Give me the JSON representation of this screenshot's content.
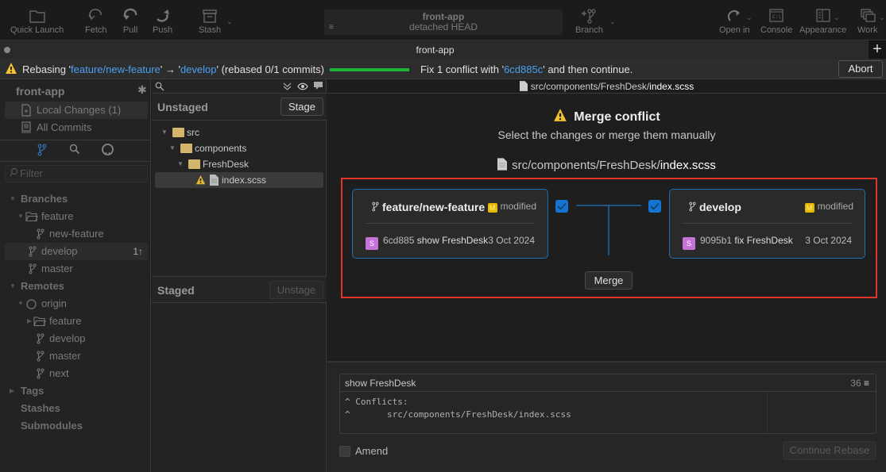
{
  "toolbar": {
    "quick_launch": "Quick Launch",
    "fetch": "Fetch",
    "pull": "Pull",
    "push": "Push",
    "stash": "Stash",
    "repo_name": "front-app",
    "repo_state": "detached HEAD",
    "branch": "Branch",
    "open_in": "Open in",
    "console": "Console",
    "appearance": "Appearance",
    "work": "Work"
  },
  "tab": {
    "title": "front-app",
    "add": "+"
  },
  "rebase": {
    "prefix": "Rebasing '",
    "source": "feature/new-feature",
    "arrow": "' → '",
    "target": "develop",
    "suffix": "' (rebased 0/1 commits)",
    "progress_fraction": 0,
    "fix_prefix": "Fix 1 conflict with '",
    "commit": "6cd885c",
    "fix_suffix": "' and then continue.",
    "abort": "Abort"
  },
  "sidebar": {
    "repo": "front-app",
    "local_changes": "Local Changes (1)",
    "all_commits": "All Commits",
    "filter_placeholder": "Filter",
    "branches_header": "Branches",
    "feature_folder": "feature",
    "new_feature": "new-feature",
    "develop": "develop",
    "develop_badge": "1↑",
    "master": "master",
    "remotes_header": "Remotes",
    "origin": "origin",
    "remote_feature": "feature",
    "remote_develop": "develop",
    "remote_master": "master",
    "remote_next": "next",
    "tags": "Tags",
    "stashes": "Stashes",
    "submodules": "Submodules"
  },
  "files": {
    "unstaged_title": "Unstaged",
    "stage": "Stage",
    "tree": [
      "src",
      "components",
      "FreshDesk",
      "index.scss"
    ],
    "staged_title": "Staged",
    "unstage": "Unstage"
  },
  "main": {
    "path_dir": "src/components/FreshDesk/",
    "path_file": "index.scss",
    "title": "Merge conflict",
    "subtitle": "Select the changes or merge them manually",
    "left": {
      "branch": "feature/new-feature",
      "status": "modified",
      "status_badge": "M",
      "avatar": "S",
      "hash": "6cd885",
      "message": "show FreshDesk",
      "date": "3 Oct 2024"
    },
    "right": {
      "branch": "develop",
      "status": "modified",
      "status_badge": "M",
      "avatar": "S",
      "hash": "9095b1",
      "message": "fix FreshDesk",
      "date": "3 Oct 2024"
    },
    "merge": "Merge"
  },
  "commit": {
    "subject": "show FreshDesk",
    "count": "36",
    "body": "^ Conflicts:\n^       src/components/FreshDesk/index.scss",
    "amend": "Amend",
    "continue": "Continue Rebase"
  }
}
